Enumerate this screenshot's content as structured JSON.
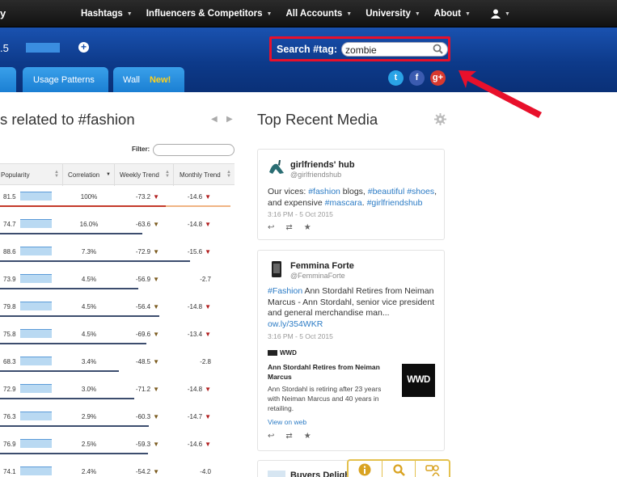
{
  "nav": {
    "brand": "y",
    "menu": [
      {
        "label": "Hashtags"
      },
      {
        "label": "Influencers & Competitors"
      },
      {
        "label": "All Accounts"
      },
      {
        "label": "University"
      },
      {
        "label": "About"
      }
    ]
  },
  "header": {
    "score": ".5",
    "search_label": "Search #tag:",
    "search_value": "zombie",
    "tabs": [
      {
        "label": "Usage Patterns"
      },
      {
        "label": "Wall",
        "badge": "New!"
      }
    ],
    "social": {
      "twitter": "t",
      "facebook": "f",
      "gplus": "g+"
    }
  },
  "left": {
    "title": "s related to #fashion",
    "filter_label": "Filter:",
    "columns": [
      "Popularity",
      "Correlation",
      "Weekly Trend",
      "Monthly Trend"
    ],
    "rows": [
      {
        "pop": "81.5",
        "corr": "100%",
        "weekly": "-73.2",
        "monthly": "-14.6"
      },
      {
        "pop": "74.7",
        "corr": "16.0%",
        "weekly": "-63.6",
        "monthly": "-14.8"
      },
      {
        "pop": "88.6",
        "corr": "7.3%",
        "weekly": "-72.9",
        "monthly": "-15.6"
      },
      {
        "pop": "73.9",
        "corr": "4.5%",
        "weekly": "-56.9",
        "monthly": "-2.7"
      },
      {
        "pop": "79.8",
        "corr": "4.5%",
        "weekly": "-56.4",
        "monthly": "-14.8"
      },
      {
        "pop": "75.8",
        "corr": "4.5%",
        "weekly": "-69.6",
        "monthly": "-13.4"
      },
      {
        "pop": "68.3",
        "corr": "3.4%",
        "weekly": "-48.5",
        "monthly": "-2.8"
      },
      {
        "pop": "72.9",
        "corr": "3.0%",
        "weekly": "-71.2",
        "monthly": "-14.8"
      },
      {
        "pop": "76.3",
        "corr": "2.9%",
        "weekly": "-60.3",
        "monthly": "-14.7"
      },
      {
        "pop": "76.9",
        "corr": "2.5%",
        "weekly": "-59.3",
        "monthly": "-14.6"
      },
      {
        "pop": "74.1",
        "corr": "2.4%",
        "weekly": "-54.2",
        "monthly": "-4.0"
      }
    ]
  },
  "right": {
    "title": "Top Recent Media",
    "post1": {
      "name": "girlfriends' hub",
      "handle": "@girlfriendshub",
      "text_pre": "Our vices: ",
      "tag1": "#fashion",
      "text_mid1": " blogs, ",
      "tag2": "#beautiful",
      "text_mid2": " ",
      "tag3": "#shoes",
      "text_mid3": ", and expensive ",
      "tag4": "#mascara",
      "text_mid4": ". ",
      "tag5": "#girlfriendshub",
      "time": "3:16 PM - 5 Oct 2015"
    },
    "post2": {
      "name": "Femmina Forte",
      "handle": "@FemminaForte",
      "tag": "#Fashion",
      "text": " Ann Stordahl Retires from Neiman Marcus - Ann Stordahl, senior vice president and general merchandise man...",
      "link": "ow.ly/354WKR",
      "time": "3:16 PM - 5 Oct 2015",
      "card_source": "WWD",
      "card_title": "Ann Stordahl Retires from Neiman Marcus",
      "card_desc": "Ann Stordahl is retiring after 23 years with Neiman Marcus and 40 years in retailing.",
      "card_logo": "WWD",
      "view_label": "View on web"
    },
    "post3": {
      "name": "Buyers Delight"
    }
  }
}
